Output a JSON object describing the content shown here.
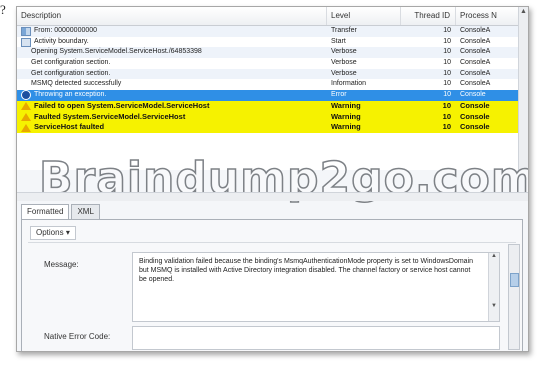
{
  "question_marker": "?",
  "grid": {
    "columns": [
      "Description",
      "Level",
      "Thread ID",
      "Process N"
    ],
    "rows": [
      {
        "style": "light",
        "icon": "transfer-icon",
        "description": "From: 00000000000",
        "level": "Transfer",
        "thread": "10",
        "process": "ConsoleA"
      },
      {
        "style": "light",
        "icon": "activity-icon",
        "description": "Activity boundary.",
        "level": "Start",
        "thread": "10",
        "process": "ConsoleA"
      },
      {
        "style": "light",
        "icon": "",
        "description": "Opening System.ServiceModel.ServiceHost./64853398",
        "level": "Verbose",
        "thread": "10",
        "process": "ConsoleA"
      },
      {
        "style": "light",
        "icon": "",
        "description": "Get configuration section.",
        "level": "Verbose",
        "thread": "10",
        "process": "ConsoleA"
      },
      {
        "style": "light",
        "icon": "",
        "description": "Get configuration section.",
        "level": "Verbose",
        "thread": "10",
        "process": "ConsoleA"
      },
      {
        "style": "light",
        "icon": "",
        "description": "MSMQ detected successfully",
        "level": "Information",
        "thread": "10",
        "process": "ConsoleA"
      },
      {
        "style": "blue",
        "icon": "error-icon",
        "description": "Throwing an exception.",
        "level": "Error",
        "thread": "10",
        "process": "Console"
      },
      {
        "style": "yellow",
        "icon": "warning-icon",
        "description": "Failed to open System.ServiceModel.ServiceHost",
        "level": "Warning",
        "thread": "10",
        "process": "Console"
      },
      {
        "style": "yellow",
        "icon": "warning-icon",
        "description": "Faulted System.ServiceModel.ServiceHost",
        "level": "Warning",
        "thread": "10",
        "process": "Console"
      },
      {
        "style": "yellow",
        "icon": "warning-icon",
        "description": "ServiceHost faulted",
        "level": "Warning",
        "thread": "10",
        "process": "Console"
      }
    ]
  },
  "watermark": "Braindump2go.com",
  "tabs": [
    "Formatted",
    "XML"
  ],
  "details": {
    "options_label": "Options",
    "options_arrow": "▾",
    "message_label": "Message:",
    "message_text": "Binding validation failed because the binding's MsmqAuthenticationMode property is set to WindowsDomain but MSMQ is installed with Active Directory integration disabled. The channel factory or service host cannot be opened.",
    "native_error_label": "Native Error Code:",
    "native_error_value": ""
  },
  "colors": {
    "selected_row": "#2f8fe6",
    "warning_row": "#f6f200",
    "light_row": "#ffffff"
  }
}
